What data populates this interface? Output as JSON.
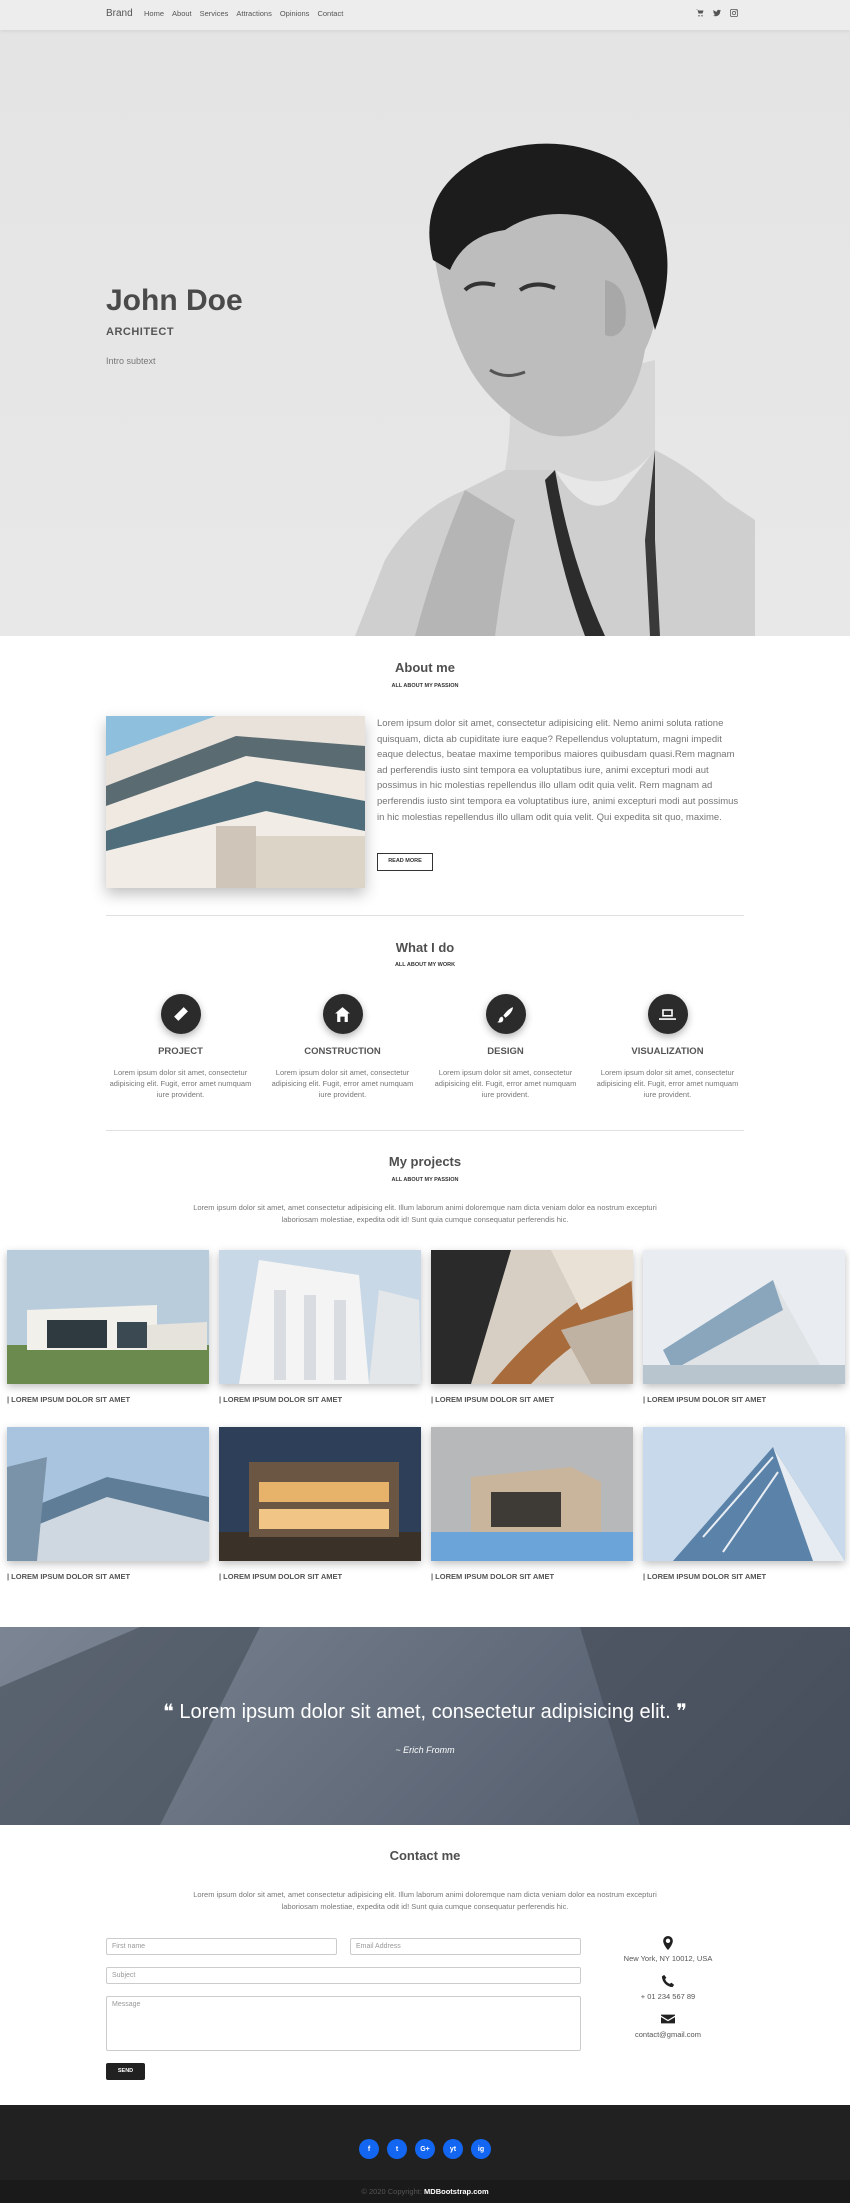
{
  "navbar": {
    "brand": "Brand",
    "links": [
      "Home",
      "About",
      "Services",
      "Attractions",
      "Opinions",
      "Contact"
    ],
    "icons": [
      "cart-icon",
      "twitter-icon",
      "instagram-icon"
    ]
  },
  "hero": {
    "name": "John Doe",
    "role": "ARCHITECT",
    "subtext": "Intro subtext"
  },
  "about": {
    "title": "About me",
    "subtitle": "ALL ABOUT MY PASSION",
    "text": "Lorem ipsum dolor sit amet, consectetur adipisicing elit. Nemo animi soluta ratione quisquam, dicta ab cupiditate iure eaque? Repellendus voluptatum, magni impedit eaque delectus, beatae maxime temporibus maiores quibusdam quasi.Rem magnam ad perferendis iusto sint tempora ea voluptatibus iure, animi excepturi modi aut possimus in hic molestias repellendus illo ullam odit quia velit. Rem magnam ad perferendis iusto sint tempora ea voluptatibus iure, animi excepturi modi aut possimus in hic molestias repellendus illo ullam odit quia velit. Qui expedita sit quo, maxime.",
    "button": "READ MORE"
  },
  "services": {
    "title": "What I do",
    "subtitle": "ALL ABOUT MY WORK",
    "items": [
      {
        "title": "PROJECT",
        "icon": "pencil-icon",
        "text": "Lorem ipsum dolor sit amet, consectetur adipisicing elit. Fugit, error amet numquam iure provident."
      },
      {
        "title": "CONSTRUCTION",
        "icon": "home-icon",
        "text": "Lorem ipsum dolor sit amet, consectetur adipisicing elit. Fugit, error amet numquam iure provident."
      },
      {
        "title": "DESIGN",
        "icon": "brush-icon",
        "text": "Lorem ipsum dolor sit amet, consectetur adipisicing elit. Fugit, error amet numquam iure provident."
      },
      {
        "title": "VISUALIZATION",
        "icon": "laptop-icon",
        "text": "Lorem ipsum dolor sit amet, consectetur adipisicing elit. Fugit, error amet numquam iure provident."
      }
    ]
  },
  "projects": {
    "title": "My projects",
    "subtitle": "ALL ABOUT MY PASSION",
    "description": "Lorem ipsum dolor sit amet, amet consectetur adipisicing elit. Illum laborum animi doloremque nam dicta veniam dolor ea nostrum excepturi laboriosam molestiae, expedita odit id! Sunt quia cumque consequatur perferendis hic.",
    "caption": "| LOREM IPSUM DOLOR SIT AMET"
  },
  "quote": {
    "text": "Lorem ipsum dolor sit amet, consectetur adipisicing elit.",
    "author": "~ Erich Fromm"
  },
  "contact": {
    "title": "Contact me",
    "description": "Lorem ipsum dolor sit amet, amet consectetur adipisicing elit. Illum laborum animi doloremque nam dicta veniam dolor ea nostrum excepturi laboriosam molestiae, expedita odit id! Sunt quia cumque consequatur perferendis hic.",
    "first_name_placeholder": "First name",
    "email_placeholder": "Email Address",
    "subject_placeholder": "Subject",
    "message_placeholder": "Message",
    "send": "SEND",
    "address": "New York, NY 10012, USA",
    "phone": "+ 01 234 567 89",
    "email": "contact@gmail.com"
  },
  "footer": {
    "socials": [
      "f",
      "t",
      "G+",
      "yt",
      "ig"
    ],
    "copyright_prefix": "© 2020 Copyright:",
    "copyright_link": "MDBootstrap.com"
  },
  "colors": {
    "accent": "#1266f1",
    "dark": "#212121"
  }
}
